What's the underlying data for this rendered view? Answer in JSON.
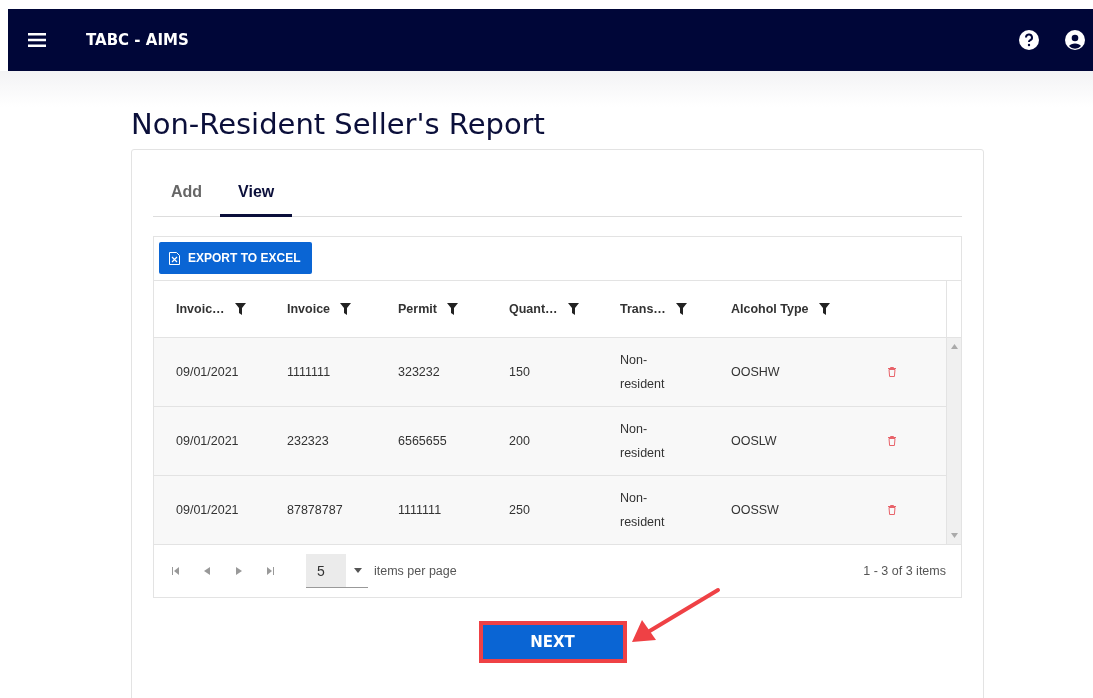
{
  "header": {
    "title": "TABC - AIMS"
  },
  "page_title": "Non-Resident Seller's Report",
  "tabs": [
    {
      "label": "Add",
      "selected": false
    },
    {
      "label": "View",
      "selected": true
    }
  ],
  "grid": {
    "toolbar_button": "EXPORT TO EXCEL",
    "columns": [
      "Invoic…",
      "Invoice",
      "Permit",
      "Quant…",
      "Trans…",
      "Alcohol Type"
    ],
    "rows": [
      {
        "cells": [
          "09/01/2021",
          "1111111",
          "323232",
          "150",
          "Non-resident",
          "OOSHW"
        ]
      },
      {
        "cells": [
          "09/01/2021",
          "232323",
          "6565655",
          "200",
          "Non-resident",
          "OOSLW"
        ]
      },
      {
        "cells": [
          "09/01/2021",
          "87878787",
          "1111111",
          "250",
          "Non-resident",
          "OOSSW"
        ]
      }
    ],
    "pager": {
      "page_size": "5",
      "page_size_label": "items per page",
      "summary": "1 - 3 of 3 items"
    }
  },
  "next_button": "NEXT"
}
